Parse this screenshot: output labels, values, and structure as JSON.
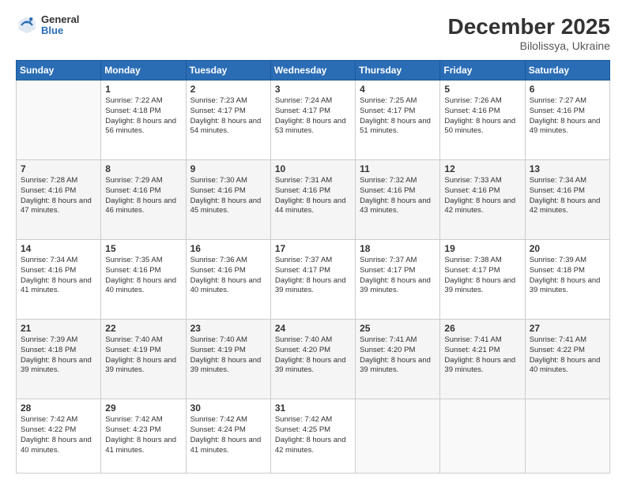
{
  "header": {
    "logo_general": "General",
    "logo_blue": "Blue",
    "month": "December 2025",
    "location": "Bilolissya, Ukraine"
  },
  "days_of_week": [
    "Sunday",
    "Monday",
    "Tuesday",
    "Wednesday",
    "Thursday",
    "Friday",
    "Saturday"
  ],
  "weeks": [
    [
      {
        "day": "",
        "sunrise": "",
        "sunset": "",
        "daylight": ""
      },
      {
        "day": "1",
        "sunrise": "Sunrise: 7:22 AM",
        "sunset": "Sunset: 4:18 PM",
        "daylight": "Daylight: 8 hours and 56 minutes."
      },
      {
        "day": "2",
        "sunrise": "Sunrise: 7:23 AM",
        "sunset": "Sunset: 4:17 PM",
        "daylight": "Daylight: 8 hours and 54 minutes."
      },
      {
        "day": "3",
        "sunrise": "Sunrise: 7:24 AM",
        "sunset": "Sunset: 4:17 PM",
        "daylight": "Daylight: 8 hours and 53 minutes."
      },
      {
        "day": "4",
        "sunrise": "Sunrise: 7:25 AM",
        "sunset": "Sunset: 4:17 PM",
        "daylight": "Daylight: 8 hours and 51 minutes."
      },
      {
        "day": "5",
        "sunrise": "Sunrise: 7:26 AM",
        "sunset": "Sunset: 4:16 PM",
        "daylight": "Daylight: 8 hours and 50 minutes."
      },
      {
        "day": "6",
        "sunrise": "Sunrise: 7:27 AM",
        "sunset": "Sunset: 4:16 PM",
        "daylight": "Daylight: 8 hours and 49 minutes."
      }
    ],
    [
      {
        "day": "7",
        "sunrise": "Sunrise: 7:28 AM",
        "sunset": "Sunset: 4:16 PM",
        "daylight": "Daylight: 8 hours and 47 minutes."
      },
      {
        "day": "8",
        "sunrise": "Sunrise: 7:29 AM",
        "sunset": "Sunset: 4:16 PM",
        "daylight": "Daylight: 8 hours and 46 minutes."
      },
      {
        "day": "9",
        "sunrise": "Sunrise: 7:30 AM",
        "sunset": "Sunset: 4:16 PM",
        "daylight": "Daylight: 8 hours and 45 minutes."
      },
      {
        "day": "10",
        "sunrise": "Sunrise: 7:31 AM",
        "sunset": "Sunset: 4:16 PM",
        "daylight": "Daylight: 8 hours and 44 minutes."
      },
      {
        "day": "11",
        "sunrise": "Sunrise: 7:32 AM",
        "sunset": "Sunset: 4:16 PM",
        "daylight": "Daylight: 8 hours and 43 minutes."
      },
      {
        "day": "12",
        "sunrise": "Sunrise: 7:33 AM",
        "sunset": "Sunset: 4:16 PM",
        "daylight": "Daylight: 8 hours and 42 minutes."
      },
      {
        "day": "13",
        "sunrise": "Sunrise: 7:34 AM",
        "sunset": "Sunset: 4:16 PM",
        "daylight": "Daylight: 8 hours and 42 minutes."
      }
    ],
    [
      {
        "day": "14",
        "sunrise": "Sunrise: 7:34 AM",
        "sunset": "Sunset: 4:16 PM",
        "daylight": "Daylight: 8 hours and 41 minutes."
      },
      {
        "day": "15",
        "sunrise": "Sunrise: 7:35 AM",
        "sunset": "Sunset: 4:16 PM",
        "daylight": "Daylight: 8 hours and 40 minutes."
      },
      {
        "day": "16",
        "sunrise": "Sunrise: 7:36 AM",
        "sunset": "Sunset: 4:16 PM",
        "daylight": "Daylight: 8 hours and 40 minutes."
      },
      {
        "day": "17",
        "sunrise": "Sunrise: 7:37 AM",
        "sunset": "Sunset: 4:17 PM",
        "daylight": "Daylight: 8 hours and 39 minutes."
      },
      {
        "day": "18",
        "sunrise": "Sunrise: 7:37 AM",
        "sunset": "Sunset: 4:17 PM",
        "daylight": "Daylight: 8 hours and 39 minutes."
      },
      {
        "day": "19",
        "sunrise": "Sunrise: 7:38 AM",
        "sunset": "Sunset: 4:17 PM",
        "daylight": "Daylight: 8 hours and 39 minutes."
      },
      {
        "day": "20",
        "sunrise": "Sunrise: 7:39 AM",
        "sunset": "Sunset: 4:18 PM",
        "daylight": "Daylight: 8 hours and 39 minutes."
      }
    ],
    [
      {
        "day": "21",
        "sunrise": "Sunrise: 7:39 AM",
        "sunset": "Sunset: 4:18 PM",
        "daylight": "Daylight: 8 hours and 39 minutes."
      },
      {
        "day": "22",
        "sunrise": "Sunrise: 7:40 AM",
        "sunset": "Sunset: 4:19 PM",
        "daylight": "Daylight: 8 hours and 39 minutes."
      },
      {
        "day": "23",
        "sunrise": "Sunrise: 7:40 AM",
        "sunset": "Sunset: 4:19 PM",
        "daylight": "Daylight: 8 hours and 39 minutes."
      },
      {
        "day": "24",
        "sunrise": "Sunrise: 7:40 AM",
        "sunset": "Sunset: 4:20 PM",
        "daylight": "Daylight: 8 hours and 39 minutes."
      },
      {
        "day": "25",
        "sunrise": "Sunrise: 7:41 AM",
        "sunset": "Sunset: 4:20 PM",
        "daylight": "Daylight: 8 hours and 39 minutes."
      },
      {
        "day": "26",
        "sunrise": "Sunrise: 7:41 AM",
        "sunset": "Sunset: 4:21 PM",
        "daylight": "Daylight: 8 hours and 39 minutes."
      },
      {
        "day": "27",
        "sunrise": "Sunrise: 7:41 AM",
        "sunset": "Sunset: 4:22 PM",
        "daylight": "Daylight: 8 hours and 40 minutes."
      }
    ],
    [
      {
        "day": "28",
        "sunrise": "Sunrise: 7:42 AM",
        "sunset": "Sunset: 4:22 PM",
        "daylight": "Daylight: 8 hours and 40 minutes."
      },
      {
        "day": "29",
        "sunrise": "Sunrise: 7:42 AM",
        "sunset": "Sunset: 4:23 PM",
        "daylight": "Daylight: 8 hours and 41 minutes."
      },
      {
        "day": "30",
        "sunrise": "Sunrise: 7:42 AM",
        "sunset": "Sunset: 4:24 PM",
        "daylight": "Daylight: 8 hours and 41 minutes."
      },
      {
        "day": "31",
        "sunrise": "Sunrise: 7:42 AM",
        "sunset": "Sunset: 4:25 PM",
        "daylight": "Daylight: 8 hours and 42 minutes."
      },
      {
        "day": "",
        "sunrise": "",
        "sunset": "",
        "daylight": ""
      },
      {
        "day": "",
        "sunrise": "",
        "sunset": "",
        "daylight": ""
      },
      {
        "day": "",
        "sunrise": "",
        "sunset": "",
        "daylight": ""
      }
    ]
  ]
}
